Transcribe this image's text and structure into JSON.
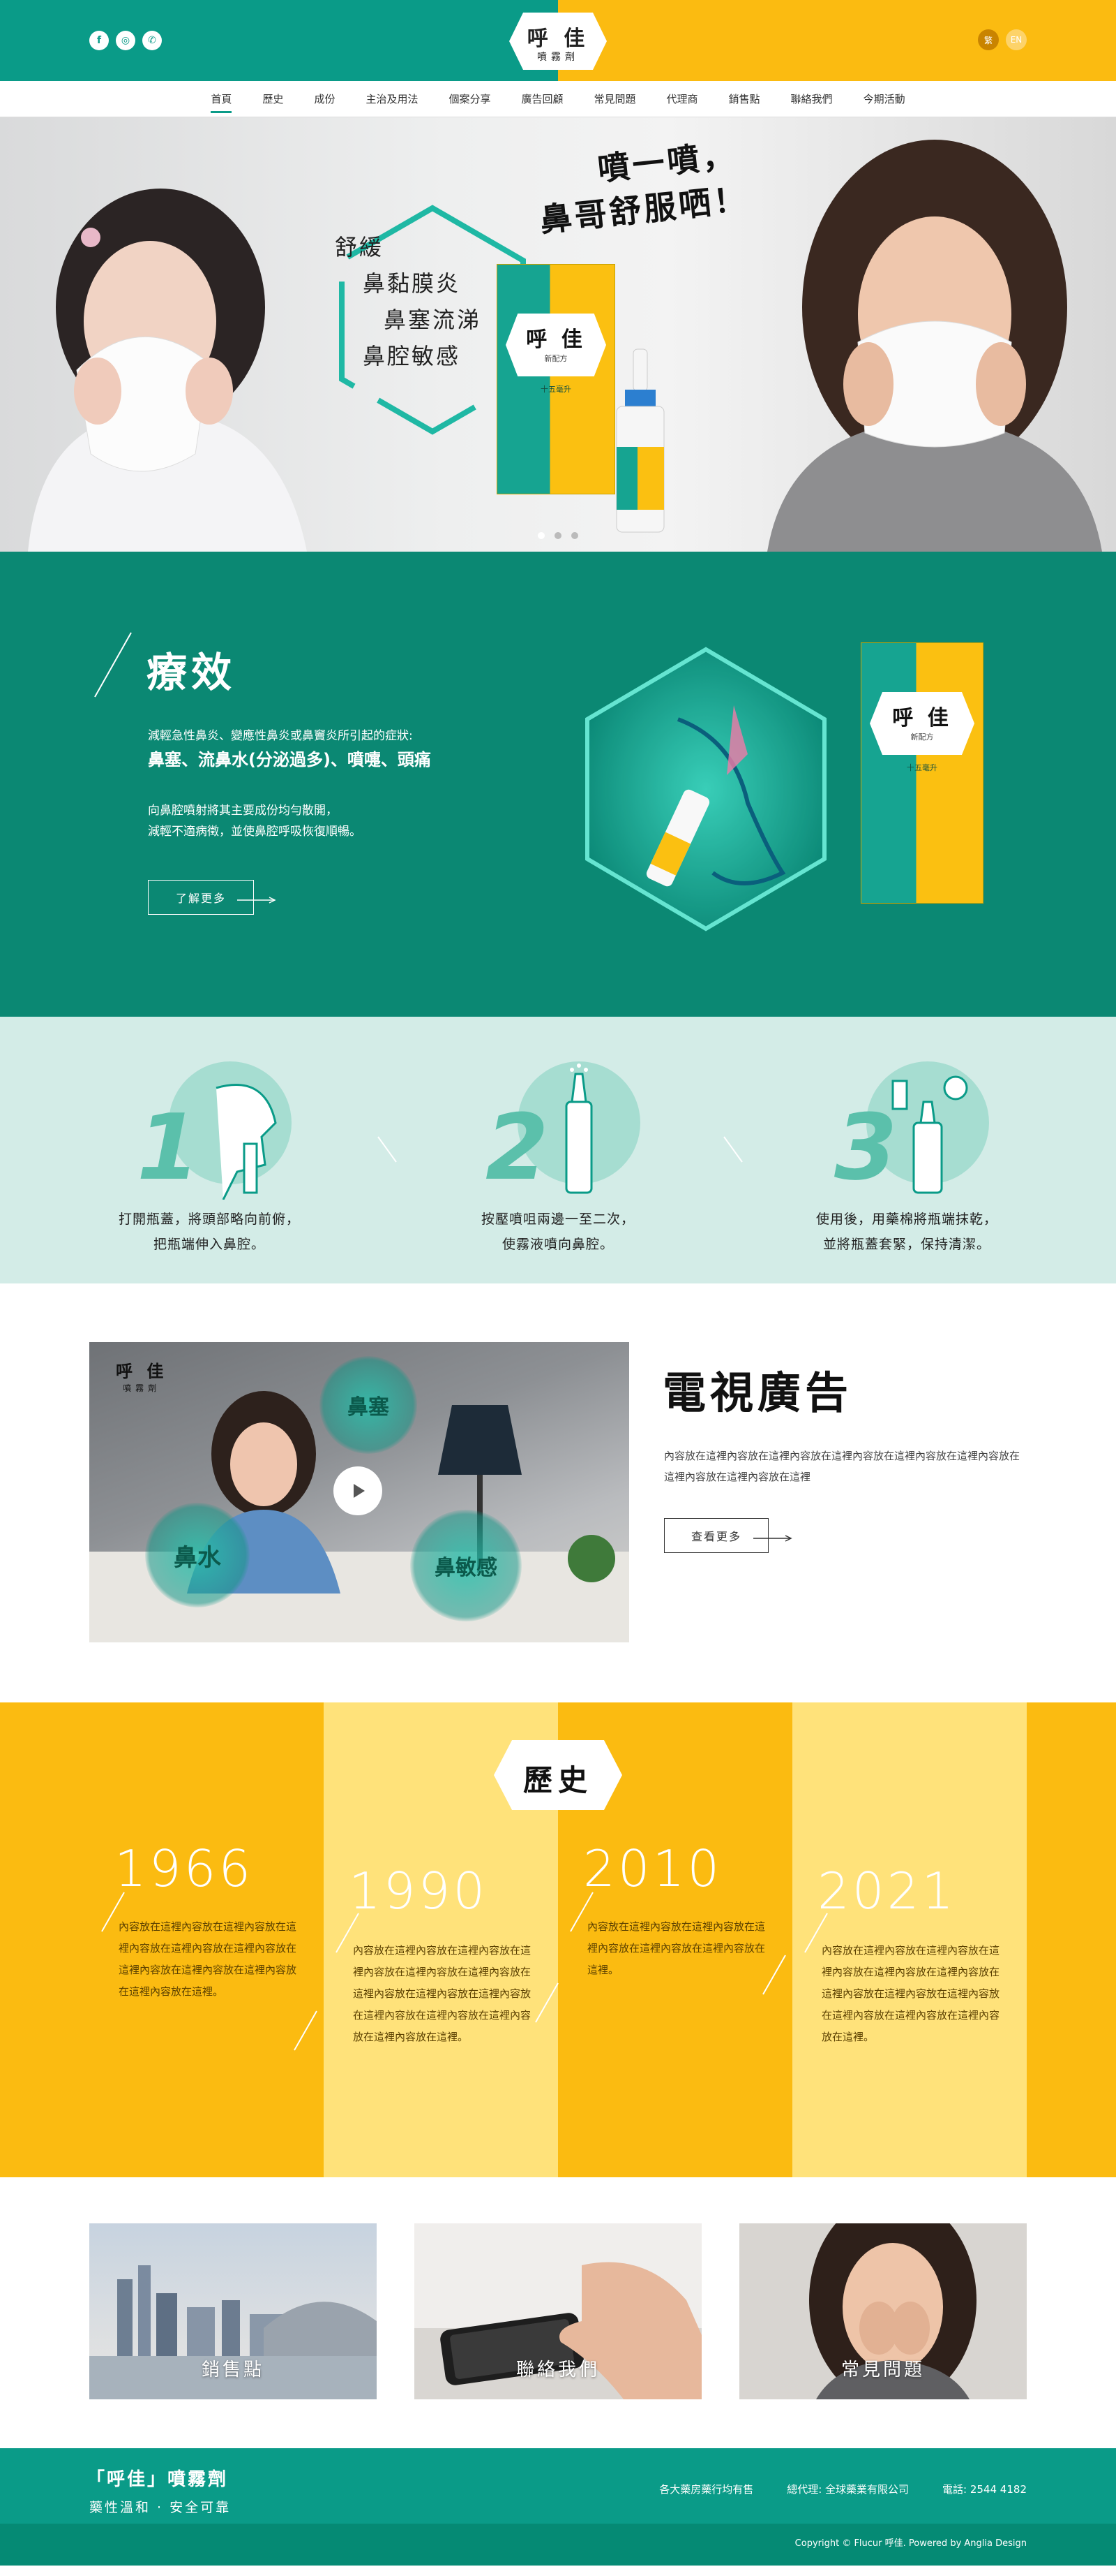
{
  "header": {
    "social": [
      {
        "name": "facebook-icon",
        "glyph": "f"
      },
      {
        "name": "instagram-icon",
        "glyph": "◎"
      },
      {
        "name": "whatsapp-icon",
        "glyph": "✆"
      }
    ],
    "logo_main": "呼 佳",
    "logo_sub": "噴霧劑",
    "lang_zh": "繁",
    "lang_en": "EN"
  },
  "nav": {
    "items": [
      "首頁",
      "歷史",
      "成份",
      "主治及用法",
      "個案分享",
      "廣告回顧",
      "常見問題",
      "代理商",
      "銷售點",
      "聯絡我們",
      "今期活動"
    ],
    "active_index": 0
  },
  "hero": {
    "slogan": [
      "噴一噴，",
      "鼻哥舒服哂！"
    ],
    "lines": [
      "舒緩",
      "鼻黏膜炎",
      "鼻塞流涕",
      "鼻腔敏感"
    ],
    "box_brand": "呼 佳",
    "box_sub": "新配方",
    "box_vol": "十五毫升",
    "slide_count": 3,
    "slide_active": 0
  },
  "efficacy": {
    "title": "療效",
    "intro": "減輕急性鼻炎、變應性鼻炎或鼻竇炎所引起的症狀:",
    "symptoms": "鼻塞、流鼻水(分泌過多)、噴嚏、頭痛",
    "desc_line1": "向鼻腔噴射將其主要成份均勻散開，",
    "desc_line2": "減輕不適病徵，並使鼻腔呼吸恢復順暢。",
    "more": "了解更多"
  },
  "steps": [
    {
      "num": "1",
      "line1": "打開瓶蓋，將頭部略向前俯，",
      "line2": "把瓶端伸入鼻腔。"
    },
    {
      "num": "2",
      "line1": "按壓噴咀兩邊一至二次，",
      "line2": "使霧液噴向鼻腔。"
    },
    {
      "num": "3",
      "line1": "使用後，用藥棉將瓶端抹乾，",
      "line2": "並將瓶蓋套緊，保持清潔。"
    }
  ],
  "tv": {
    "title": "電視廣告",
    "desc": "內容放在這裡內容放在這裡內容放在這裡內容放在這裡內容放在這裡內容放在這裡內容放在這裡內容放在這裡",
    "more": "查看更多",
    "video_logo_main": "呼 佳",
    "video_logo_sub": "噴霧劑",
    "bubbles": [
      "鼻塞",
      "鼻水",
      "鼻敏感"
    ]
  },
  "history": {
    "title": "歷史",
    "colors": {
      "dark": "#fbbb11",
      "light": "#ffe27a"
    },
    "entries": [
      {
        "year": "1966",
        "text": "內容放在這裡內容放在這裡內容放在這裡內容放在這裡內容放在這裡內容放在這裡內容放在這裡內容放在這裡內容放在這裡內容放在這裡。"
      },
      {
        "year": "1990",
        "text": "內容放在這裡內容放在這裡內容放在這裡內容放在這裡內容放在這裡內容放在這裡內容放在這裡內容放在這裡內容放在這裡內容放在這裡內容放在這裡內容放在這裡內容放在這裡。"
      },
      {
        "year": "2010",
        "text": "內容放在這裡內容放在這裡內容放在這裡內容放在這裡內容放在這裡內容放在這裡。"
      },
      {
        "year": "2021",
        "text": "內容放在這裡內容放在這裡內容放在這裡內容放在這裡內容放在這裡內容放在這裡內容放在這裡內容放在這裡內容放在這裡內容放在這裡內容放在這裡內容放在這裡。"
      }
    ]
  },
  "cards": [
    {
      "label": "銷售點",
      "icon": "city-skyline-photo"
    },
    {
      "label": "聯絡我們",
      "icon": "phone-hand-photo"
    },
    {
      "label": "常見問題",
      "icon": "woman-nose-photo"
    }
  ],
  "footer": {
    "brand": "「呼佳」噴霧劑",
    "tagline": "藥性溫和 · 安全可靠",
    "stores": "各大藥房藥行均有售",
    "agent": "總代理: 全球藥業有限公司",
    "phone": "電話: 2544 4182",
    "copyright": "Copyright © Flucur 呼佳. Powered by Anglia Design"
  },
  "colors": {
    "teal": "#0a9b88",
    "teal_dark": "#0b8873",
    "yellow": "#fbbb11",
    "mint": "#d3ece7"
  }
}
